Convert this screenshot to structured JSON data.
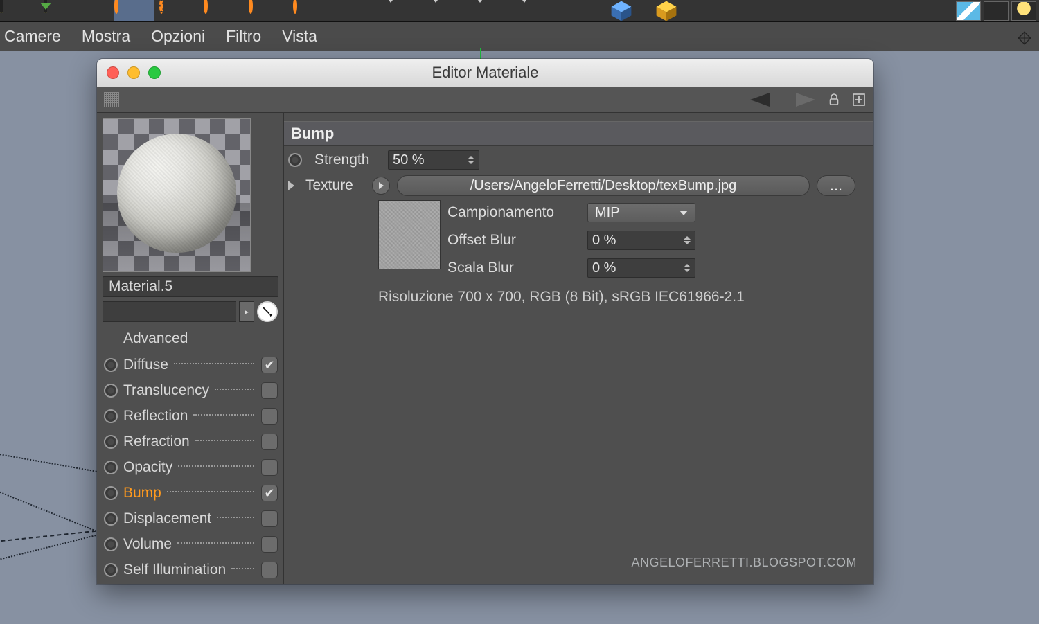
{
  "menubar": {
    "items": [
      "Camere",
      "Mostra",
      "Opzioni",
      "Filtro",
      "Vista"
    ]
  },
  "window": {
    "title": "Editor Materiale",
    "material_name": "Material.5",
    "advanced_label": "Advanced",
    "properties": [
      {
        "label": "Diffuse",
        "checked": true,
        "active": false
      },
      {
        "label": "Translucency",
        "checked": false,
        "active": false
      },
      {
        "label": "Reflection",
        "checked": false,
        "active": false
      },
      {
        "label": "Refraction",
        "checked": false,
        "active": false
      },
      {
        "label": "Opacity",
        "checked": false,
        "active": false
      },
      {
        "label": "Bump",
        "checked": true,
        "active": true
      },
      {
        "label": "Displacement",
        "checked": false,
        "active": false
      },
      {
        "label": "Volume",
        "checked": false,
        "active": false
      },
      {
        "label": "Self Illumination",
        "checked": false,
        "active": false
      }
    ],
    "section_title": "Bump",
    "strength_label": "Strength",
    "strength_value": "50 %",
    "texture_label": "Texture",
    "texture_path": "/Users/AngeloFerretti/Desktop/texBump.jpg",
    "browse_label": "...",
    "sampling_label": "Campionamento",
    "sampling_value": "MIP",
    "offset_blur_label": "Offset Blur",
    "offset_blur_value": "0 %",
    "scale_blur_label": "Scala Blur",
    "scale_blur_value": "0 %",
    "resolution_line": "Risoluzione 700 x 700, RGB (8 Bit), sRGB IEC61966-2.1"
  },
  "watermark": "ANGELOFERRETTI.BLOGSPOT.COM"
}
